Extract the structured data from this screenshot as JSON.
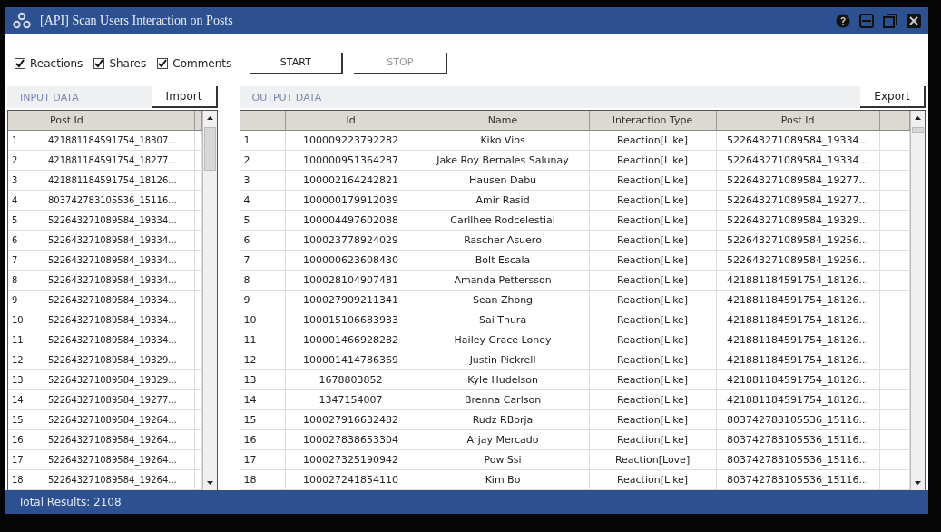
{
  "window": {
    "title": "[API] Scan Users Interaction on Posts"
  },
  "options": [
    {
      "label": "Reactions",
      "checked": true
    },
    {
      "label": "Shares",
      "checked": true
    },
    {
      "label": "Comments",
      "checked": true
    }
  ],
  "buttons": [
    {
      "label": "START",
      "disabled": false
    },
    {
      "label": "STOP",
      "disabled": true
    }
  ],
  "input_data": {
    "title": "INPUT DATA",
    "action": "Import",
    "columns": [
      "",
      "Post Id"
    ],
    "rows": [
      [
        "1",
        "421881184591754_18307..."
      ],
      [
        "2",
        "421881184591754_18277..."
      ],
      [
        "3",
        "421881184591754_18126..."
      ],
      [
        "4",
        "803742783105536_15116..."
      ],
      [
        "5",
        "522643271089584_19334..."
      ],
      [
        "6",
        "522643271089584_19334..."
      ],
      [
        "7",
        "522643271089584_19334..."
      ],
      [
        "8",
        "522643271089584_19334..."
      ],
      [
        "9",
        "522643271089584_19334..."
      ],
      [
        "10",
        "522643271089584_19334..."
      ],
      [
        "11",
        "522643271089584_19334..."
      ],
      [
        "12",
        "522643271089584_19329..."
      ],
      [
        "13",
        "522643271089584_19329..."
      ],
      [
        "14",
        "522643271089584_19277..."
      ],
      [
        "15",
        "522643271089584_19264..."
      ],
      [
        "16",
        "522643271089584_19264..."
      ],
      [
        "17",
        "522643271089584_19264..."
      ],
      [
        "18",
        "522643271089584_19264..."
      ]
    ]
  },
  "output_data": {
    "title": "OUTPUT DATA",
    "action": "Export",
    "columns": [
      "",
      "Id",
      "Name",
      "Interaction Type",
      "Post Id"
    ],
    "rows": [
      [
        "1",
        "100009223792282",
        "Kiko Vios",
        "Reaction[Like]",
        "522643271089584_19334..."
      ],
      [
        "2",
        "100000951364287",
        "Jake Roy Bernales Salunay",
        "Reaction[Like]",
        "522643271089584_19334..."
      ],
      [
        "3",
        "100002164242821",
        "Hausen Dabu",
        "Reaction[Like]",
        "522643271089584_19277..."
      ],
      [
        "4",
        "100000179912039",
        "Amir Rasid",
        "Reaction[Like]",
        "522643271089584_19277..."
      ],
      [
        "5",
        "100004497602088",
        "Carllhee Rodcelestial",
        "Reaction[Like]",
        "522643271089584_19329..."
      ],
      [
        "6",
        "100023778924029",
        "Rascher Asuero",
        "Reaction[Like]",
        "522643271089584_19256..."
      ],
      [
        "7",
        "100000623608430",
        "Bolt Escala",
        "Reaction[Like]",
        "522643271089584_19256..."
      ],
      [
        "8",
        "100028104907481",
        "Amanda Pettersson",
        "Reaction[Like]",
        "421881184591754_18126..."
      ],
      [
        "9",
        "100027909211341",
        "Sean Zhong",
        "Reaction[Like]",
        "421881184591754_18126..."
      ],
      [
        "10",
        "100015106683933",
        "Sai Thura",
        "Reaction[Like]",
        "421881184591754_18126..."
      ],
      [
        "11",
        "100001466928282",
        "Hailey Grace Loney",
        "Reaction[Like]",
        "421881184591754_18126..."
      ],
      [
        "12",
        "100001414786369",
        "Justin Pickrell",
        "Reaction[Like]",
        "421881184591754_18126..."
      ],
      [
        "13",
        "1678803852",
        "Kyle Hudelson",
        "Reaction[Like]",
        "421881184591754_18126..."
      ],
      [
        "14",
        "1347154007",
        "Brenna Carlson",
        "Reaction[Like]",
        "421881184591754_18126..."
      ],
      [
        "15",
        "100027916632482",
        "Rudz RBorja",
        "Reaction[Like]",
        "803742783105536_15116..."
      ],
      [
        "16",
        "100027838653304",
        "Arjay Mercado",
        "Reaction[Like]",
        "803742783105536_15116..."
      ],
      [
        "17",
        "100027325190942",
        "Pow Ssi",
        "Reaction[Love]",
        "803742783105536_15116..."
      ],
      [
        "18",
        "100027241854110",
        "Kim Bo",
        "Reaction[Like]",
        "803742783105536_15116..."
      ]
    ]
  },
  "status_bar": "Total Results: 2108"
}
